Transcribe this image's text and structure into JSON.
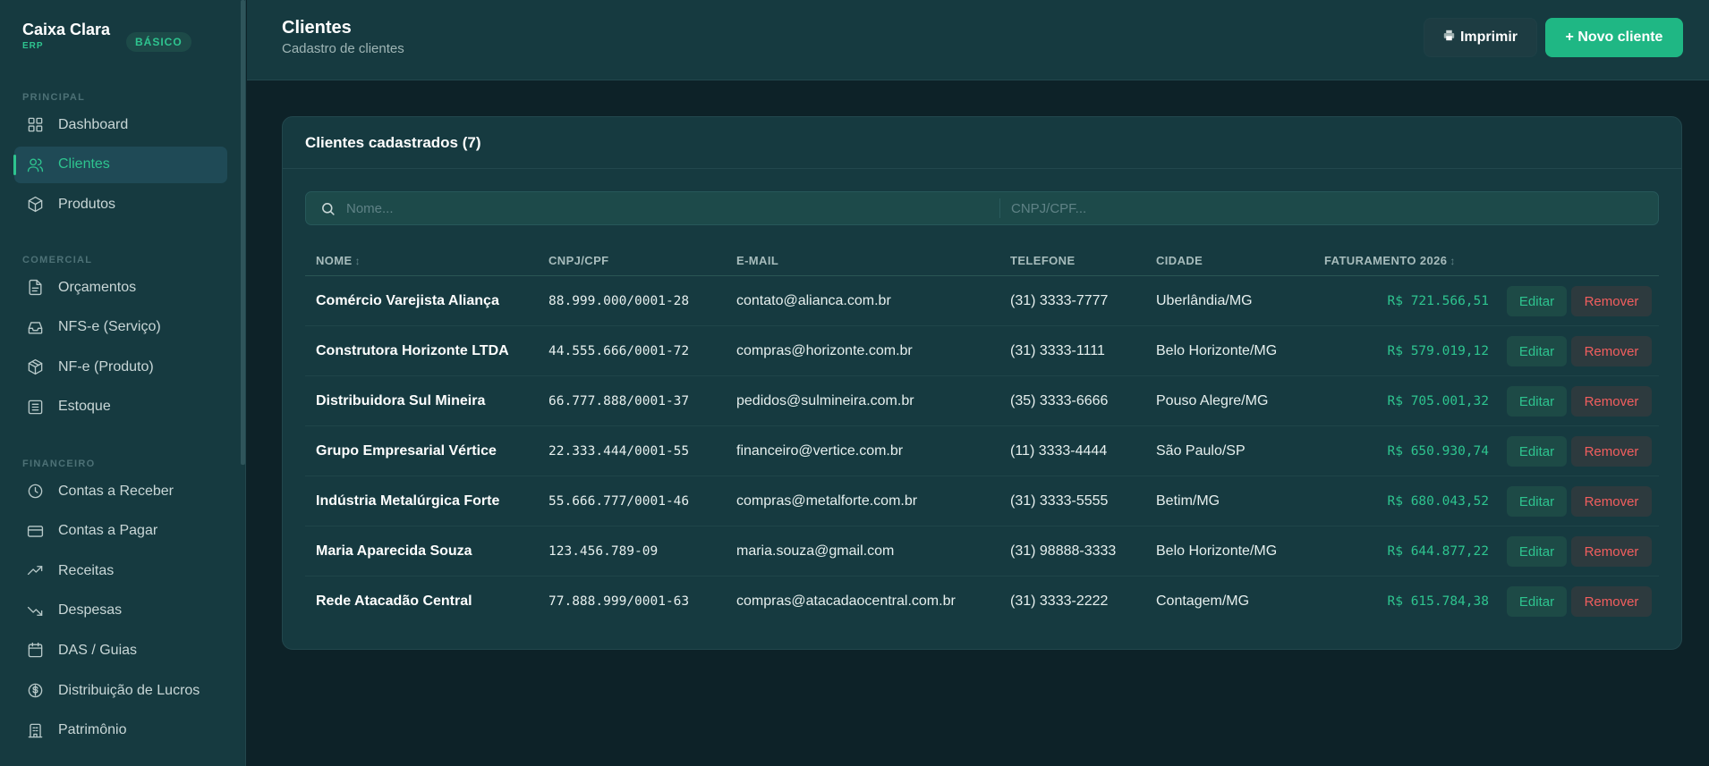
{
  "app": {
    "name": "Caixa Clara",
    "sub": "ERP",
    "plan": "BÁSICO"
  },
  "sidebar": {
    "sections": [
      {
        "title": "PRINCIPAL",
        "items": [
          {
            "label": "Dashboard",
            "icon": "grid-icon",
            "active": false
          },
          {
            "label": "Clientes",
            "icon": "users-icon",
            "active": true
          },
          {
            "label": "Produtos",
            "icon": "package-icon",
            "active": false
          }
        ]
      },
      {
        "title": "COMERCIAL",
        "items": [
          {
            "label": "Orçamentos",
            "icon": "file-text-icon",
            "active": false
          },
          {
            "label": "NFS-e (Serviço)",
            "icon": "inbox-icon",
            "active": false
          },
          {
            "label": "NF-e (Produto)",
            "icon": "box-icon",
            "active": false
          },
          {
            "label": "Estoque",
            "icon": "list-icon",
            "active": false
          }
        ]
      },
      {
        "title": "FINANCEIRO",
        "items": [
          {
            "label": "Contas a Receber",
            "icon": "clock-icon",
            "active": false
          },
          {
            "label": "Contas a Pagar",
            "icon": "credit-card-icon",
            "active": false
          },
          {
            "label": "Receitas",
            "icon": "trending-up-icon",
            "active": false
          },
          {
            "label": "Despesas",
            "icon": "trending-down-icon",
            "active": false
          },
          {
            "label": "DAS / Guias",
            "icon": "calendar-icon",
            "active": false
          },
          {
            "label": "Distribuição de Lucros",
            "icon": "dollar-circle-icon",
            "active": false
          },
          {
            "label": "Patrimônio",
            "icon": "building-icon",
            "active": false
          }
        ]
      }
    ]
  },
  "header": {
    "title": "Clientes",
    "subtitle": "Cadastro de clientes",
    "print_label": "Imprimir",
    "new_label": "+ Novo cliente"
  },
  "card": {
    "title": "Clientes cadastrados (7)"
  },
  "filters": {
    "name_placeholder": "Nome...",
    "doc_placeholder": "CNPJ/CPF..."
  },
  "table": {
    "columns": {
      "name": "NOME",
      "doc": "CNPJ/CPF",
      "email": "E-MAIL",
      "phone": "TELEFONE",
      "city": "CIDADE",
      "revenue": "FATURAMENTO 2026"
    },
    "edit_label": "Editar",
    "remove_label": "Remover",
    "rows": [
      {
        "name": "Comércio Varejista Aliança",
        "doc": "88.999.000/0001-28",
        "email": "contato@alianca.com.br",
        "phone": "(31) 3333-7777",
        "city": "Uberlândia/MG",
        "revenue": "R$ 721.566,51"
      },
      {
        "name": "Construtora Horizonte LTDA",
        "doc": "44.555.666/0001-72",
        "email": "compras@horizonte.com.br",
        "phone": "(31) 3333-1111",
        "city": "Belo Horizonte/MG",
        "revenue": "R$ 579.019,12"
      },
      {
        "name": "Distribuidora Sul Mineira",
        "doc": "66.777.888/0001-37",
        "email": "pedidos@sulmineira.com.br",
        "phone": "(35) 3333-6666",
        "city": "Pouso Alegre/MG",
        "revenue": "R$ 705.001,32"
      },
      {
        "name": "Grupo Empresarial Vértice",
        "doc": "22.333.444/0001-55",
        "email": "financeiro@vertice.com.br",
        "phone": "(11) 3333-4444",
        "city": "São Paulo/SP",
        "revenue": "R$ 650.930,74"
      },
      {
        "name": "Indústria Metalúrgica Forte",
        "doc": "55.666.777/0001-46",
        "email": "compras@metalforte.com.br",
        "phone": "(31) 3333-5555",
        "city": "Betim/MG",
        "revenue": "R$ 680.043,52"
      },
      {
        "name": "Maria Aparecida Souza",
        "doc": "123.456.789-09",
        "email": "maria.souza@gmail.com",
        "phone": "(31) 98888-3333",
        "city": "Belo Horizonte/MG",
        "revenue": "R$ 644.877,22"
      },
      {
        "name": "Rede Atacadão Central",
        "doc": "77.888.999/0001-63",
        "email": "compras@atacadaocentral.com.br",
        "phone": "(31) 3333-2222",
        "city": "Contagem/MG",
        "revenue": "R$ 615.784,38"
      }
    ]
  },
  "colors": {
    "accent": "#2ec48f",
    "danger": "#f25e5e",
    "background": "#0d2228",
    "panel": "#163a40"
  }
}
